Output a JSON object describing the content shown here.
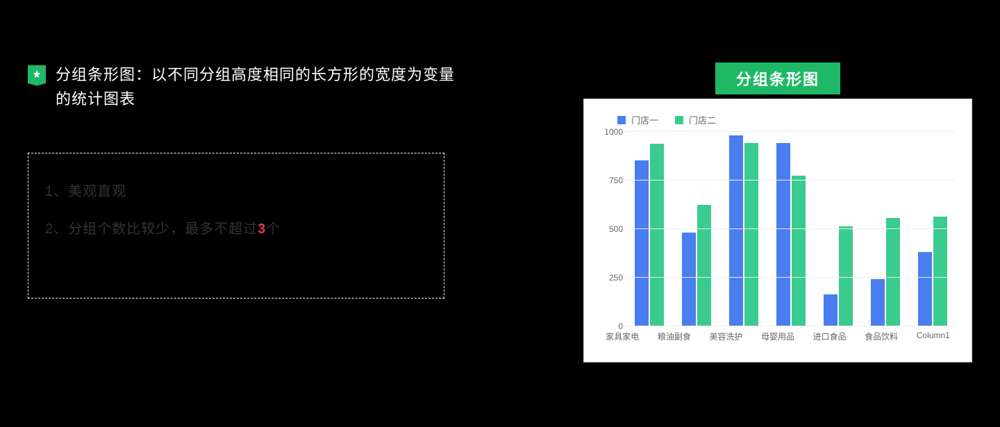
{
  "title": "分组条形图：以不同分组高度相同的长方形的宽度为变量的统计图表",
  "hint_line1": "1、美观直观",
  "hint_line2_prefix": "2、分组个数比较少，最多不超过",
  "hint_line2_red": "3",
  "hint_line2_suffix": "个",
  "chart_title": "分组条形图",
  "legend": {
    "s1": "门店一",
    "s2": "门店二"
  },
  "y_ticks": [
    "0",
    "250",
    "500",
    "750",
    "1000"
  ],
  "chart_data": {
    "type": "bar",
    "title": "分组条形图",
    "xlabel": "",
    "ylabel": "",
    "ylim": [
      0,
      1000
    ],
    "categories": [
      "家具家电",
      "粮油副食",
      "美容洗护",
      "母婴用品",
      "进口食品",
      "食品饮料",
      "Column1"
    ],
    "series": [
      {
        "name": "门店一",
        "values": [
          850,
          480,
          980,
          940,
          160,
          240,
          380
        ]
      },
      {
        "name": "门店二",
        "values": [
          935,
          620,
          940,
          770,
          510,
          555,
          560
        ]
      }
    ],
    "legend_position": "top-left",
    "grid": true
  }
}
